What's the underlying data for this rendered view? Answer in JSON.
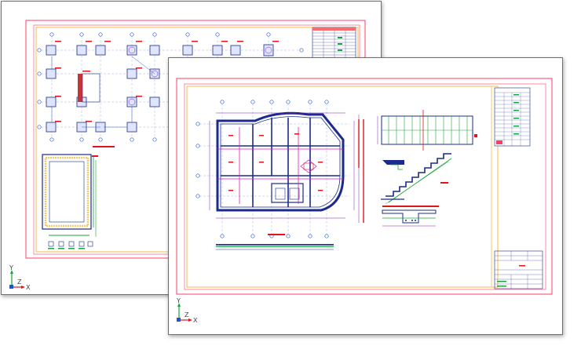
{
  "back_sheet": {
    "ucs": {
      "y_label": "Y",
      "z_label": "Z",
      "x_label": "X"
    }
  },
  "front_sheet": {
    "ucs": {
      "y_label": "Y",
      "z_label": "Z",
      "x_label": "X"
    }
  },
  "colors": {
    "border_outer": "#ff3b6b",
    "border_inner": "#f3c96a",
    "grid_bubble": "#2f5fd6",
    "wall": "#1c2a8c",
    "dimension": "#7a1fbf",
    "rebar": "#18a43a",
    "label": "#e0151b",
    "axis_x": "#e0151b",
    "axis_y": "#18a43a",
    "axis_z": "#1b55d6"
  }
}
